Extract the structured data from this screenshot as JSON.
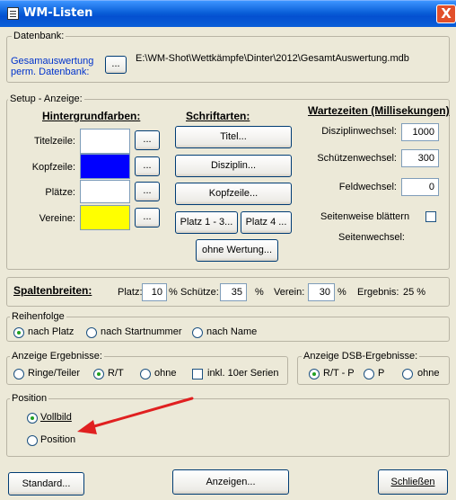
{
  "window": {
    "title": "WM-Listen",
    "close_label": "X"
  },
  "datenbank": {
    "legend": "Datenbank:",
    "label_line1": "Gesamauswertung",
    "label_line2": "perm. Datenbank:",
    "browse_label": "...",
    "path": "E:\\WM-Shot\\Wettkämpfe\\Dinter\\2012\\GesamtAuswertung.mdb"
  },
  "setup": {
    "legend": "Setup - Anzeige:",
    "hintergrund": {
      "heading": "Hintergrundfarben:",
      "rows": [
        {
          "label": "Titelzeile:",
          "color": "#ffffff",
          "button": "..."
        },
        {
          "label": "Kopfzeile:",
          "color": "#0000ff",
          "button": "..."
        },
        {
          "label": "Plätze:",
          "color": "#ffffff",
          "button": "..."
        },
        {
          "label": "Vereine:",
          "color": "#ffff00",
          "button": "..."
        }
      ]
    },
    "schrift": {
      "heading": "Schriftarten:",
      "titel": "Titel...",
      "disziplin": "Disziplin...",
      "kopfzeile": "Kopfzeile...",
      "platz13": "Platz 1 - 3...",
      "platz4": "Platz 4 ...",
      "ohne_wertung": "ohne Wertung..."
    },
    "wartezeiten": {
      "heading": "Wartezeiten (Millisekungen)",
      "disziplin_label": "Disziplinwechsel:",
      "disziplin_value": "1000",
      "schuetzen_label": "Schützenwechsel:",
      "schuetzen_value": "300",
      "feld_label": "Feldwechsel:",
      "feld_value": "0",
      "seitenweise_label": "Seitenweise blättern",
      "seitenwechsel_label": "Seitenwechsel:"
    }
  },
  "spalten": {
    "heading": "Spaltenbreiten:",
    "platz_label": "Platz:",
    "platz_value": "10",
    "pct1": "%",
    "schuetze_label": "Schütze:",
    "schuetze_value": "35",
    "pct2": "%",
    "verein_label": "Verein:",
    "verein_value": "30",
    "pct3": "%",
    "ergebnis_label": "Ergebnis:",
    "ergebnis_value": "25 %"
  },
  "reihenfolge": {
    "legend": "Reihenfolge",
    "options": [
      "nach Platz",
      "nach Startnummer",
      "nach Name"
    ]
  },
  "ergebnisse": {
    "legend": "Anzeige Ergebnisse:",
    "options": [
      "Ringe/Teiler",
      "R/T",
      "ohne"
    ],
    "checkbox": "inkl. 10er Serien"
  },
  "dsb": {
    "legend": "Anzeige DSB-Ergebnisse:",
    "options": [
      "R/T - P",
      "P",
      "ohne"
    ]
  },
  "position": {
    "legend": "Position",
    "options": [
      "Vollbild",
      "Position"
    ]
  },
  "buttons": {
    "standard": "Standard...",
    "anzeigen": "Anzeigen...",
    "schliessen": "Schließen"
  },
  "colors": {
    "annotation_arrow": "#e02020",
    "titlebar": "#0a5fd8"
  }
}
